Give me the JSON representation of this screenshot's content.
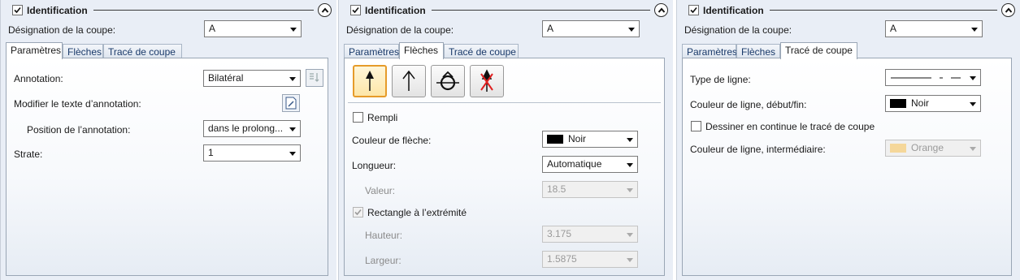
{
  "panel1": {
    "header_title": "Identification",
    "designation_label": "Désignation de la coupe:",
    "designation_value": "A",
    "tabs": [
      "Paramètres",
      "Flèches",
      "Tracé de coupe"
    ],
    "annotation_label": "Annotation:",
    "annotation_value": "Bilatéral",
    "modify_label": "Modifier le texte d’annotation:",
    "position_label": "Position de l’annotation:",
    "position_value": "dans le prolong...",
    "strate_label": "Strate:",
    "strate_value": "1"
  },
  "panel2": {
    "header_title": "Identification",
    "designation_label": "Désignation de la coupe:",
    "designation_value": "A",
    "tabs": [
      "Paramètres",
      "Flèches",
      "Tracé de coupe"
    ],
    "rempli_label": "Rempli",
    "couleur_fleche_label": "Couleur de flèche:",
    "couleur_fleche_value": "Noir",
    "longueur_label": "Longueur:",
    "longueur_value": "Automatique",
    "valeur_label": "Valeur:",
    "valeur_value": "18.5",
    "rectangle_label": "Rectangle à l’extrémité",
    "hauteur_label": "Hauteur:",
    "hauteur_value": "3.175",
    "largeur_label": "Largeur:",
    "largeur_value": "1.5875"
  },
  "panel3": {
    "header_title": "Identification",
    "designation_label": "Désignation de la coupe:",
    "designation_value": "A",
    "tabs": [
      "Paramètres",
      "Flèches",
      "Tracé de coupe"
    ],
    "type_ligne_label": "Type de ligne:",
    "couleur_debut_label": "Couleur de ligne, début/fin:",
    "couleur_debut_value": "Noir",
    "dessiner_label": "Dessiner en continue le tracé de coupe",
    "couleur_inter_label": "Couleur de ligne, intermédiaire:",
    "couleur_inter_value": "Orange"
  },
  "colors": {
    "black_swatch": "#000000",
    "orange_swatch": "#f5d79a",
    "active_arrow_border": "#e69b2a",
    "tab_text": "#1a3a6a"
  }
}
